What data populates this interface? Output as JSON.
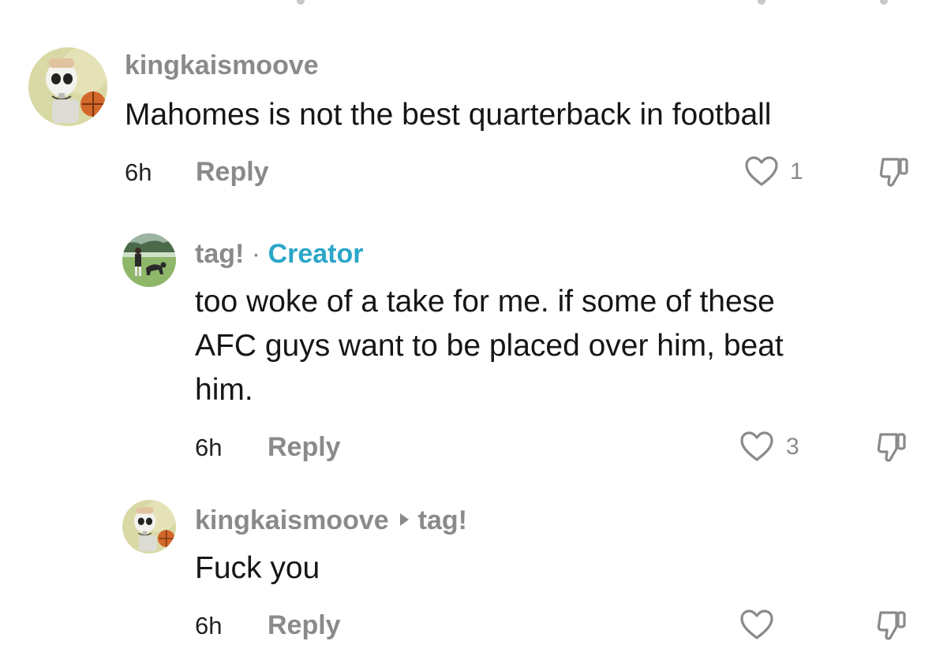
{
  "comments": [
    {
      "username": "kingkaismoove",
      "text": "Mahomes is not the best quarterback in football",
      "time": "6h",
      "reply_label": "Reply",
      "likes": "1",
      "avatar": "skeleton-basketball-avatar"
    },
    {
      "username": "tag!",
      "separator": "·",
      "badge": "Creator",
      "text": "too woke of a take for me. if some of these\nAFC guys want to be placed over him, beat\nhim.",
      "time": "6h",
      "reply_label": "Reply",
      "likes": "3",
      "avatar": "person-with-dog-avatar"
    },
    {
      "username": "kingkaismoove",
      "reply_to": "tag!",
      "text": "Fuck you",
      "time": "6h",
      "reply_label": "Reply",
      "likes": "",
      "avatar": "skeleton-basketball-avatar"
    }
  ],
  "colors": {
    "username": "#8a8a8a",
    "creator_badge": "#2aa6c8",
    "text": "#161616"
  }
}
